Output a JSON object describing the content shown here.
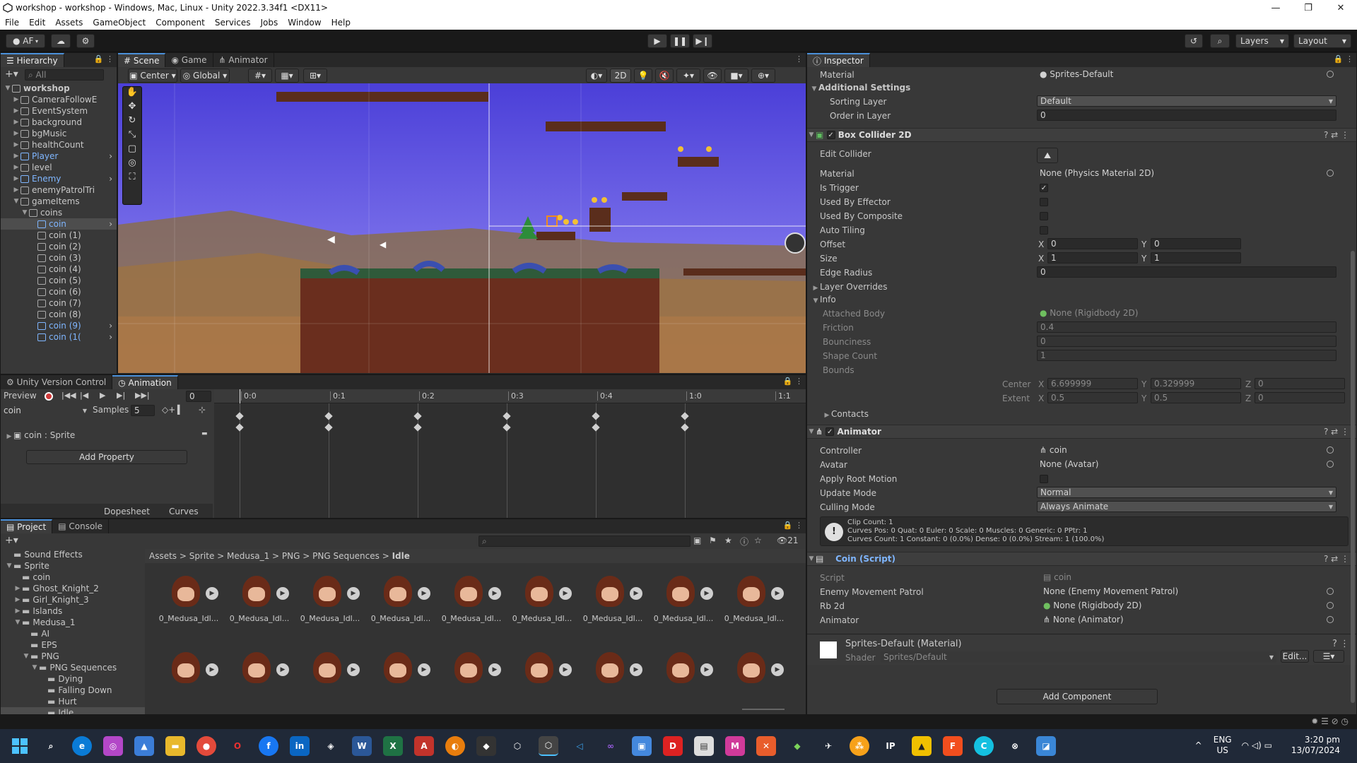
{
  "window": {
    "title": "workshop - workshop - Windows, Mac, Linux - Unity 2022.3.34f1 <DX11>",
    "controls": [
      "—",
      "❐",
      "✕"
    ]
  },
  "menu": [
    "File",
    "Edit",
    "Assets",
    "GameObject",
    "Component",
    "Services",
    "Jobs",
    "Window",
    "Help"
  ],
  "toolbar": {
    "account": "AF",
    "layers_label": "Layers",
    "layout_label": "Layout"
  },
  "hierarchy": {
    "tab": "Hierarchy",
    "search_placeholder": "All",
    "items": [
      {
        "label": "workshop",
        "indent": 0,
        "expanded": true,
        "scene": true
      },
      {
        "label": "CameraFollowE",
        "indent": 1
      },
      {
        "label": "EventSystem",
        "indent": 1
      },
      {
        "label": "background",
        "indent": 1
      },
      {
        "label": "bgMusic",
        "indent": 1
      },
      {
        "label": "healthCount",
        "indent": 1
      },
      {
        "label": "Player",
        "indent": 1,
        "prefab": true
      },
      {
        "label": "level",
        "indent": 1
      },
      {
        "label": "Enemy",
        "indent": 1,
        "prefab": true
      },
      {
        "label": "enemyPatrolTri",
        "indent": 1
      },
      {
        "label": "gameItems",
        "indent": 1,
        "expanded": true
      },
      {
        "label": "coins",
        "indent": 2,
        "expanded": true
      },
      {
        "label": "coin",
        "indent": 3,
        "selected": true,
        "prefab": true
      },
      {
        "label": "coin (1)",
        "indent": 3
      },
      {
        "label": "coin (2)",
        "indent": 3
      },
      {
        "label": "coin (3)",
        "indent": 3
      },
      {
        "label": "coin (4)",
        "indent": 3
      },
      {
        "label": "coin (5)",
        "indent": 3
      },
      {
        "label": "coin (6)",
        "indent": 3
      },
      {
        "label": "coin (7)",
        "indent": 3
      },
      {
        "label": "coin (8)",
        "indent": 3
      },
      {
        "label": "coin (9)",
        "indent": 3,
        "prefab": true
      },
      {
        "label": "coin (1(",
        "indent": 3,
        "prefab": true
      }
    ]
  },
  "scene_tabs": [
    "Scene",
    "Game",
    "Animator"
  ],
  "scene_toolbar": {
    "pivot": "Center",
    "space": "Global",
    "mode_2d": "2D"
  },
  "animation": {
    "tabs": [
      "Unity Version Control",
      "Animation"
    ],
    "preview": "Preview",
    "frame": "0",
    "clip": "coin",
    "samples_label": "Samples",
    "samples_value": "5",
    "property": "coin : Sprite",
    "add_property": "Add Property",
    "time_ticks": [
      "0:0",
      "0:1",
      "0:2",
      "0:3",
      "0:4",
      "1:0",
      "1:1"
    ],
    "bottom_tabs": [
      "Dopesheet",
      "Curves"
    ]
  },
  "project": {
    "tabs": [
      "Project",
      "Console"
    ],
    "breadcrumb": [
      "Assets",
      "Sprite",
      "Medusa_1",
      "PNG",
      "PNG Sequences",
      "Idle"
    ],
    "count": "21",
    "tree": [
      {
        "label": "Sound Effects",
        "indent": 1
      },
      {
        "label": "Sprite",
        "indent": 1,
        "expanded": true
      },
      {
        "label": "coin",
        "indent": 2
      },
      {
        "label": "Ghost_Knight_2",
        "indent": 2,
        "collapsed": true
      },
      {
        "label": "Girl_Knight_3",
        "indent": 2,
        "collapsed": true
      },
      {
        "label": "Islands",
        "indent": 2,
        "collapsed": true
      },
      {
        "label": "Medusa_1",
        "indent": 2,
        "expanded": true
      },
      {
        "label": "AI",
        "indent": 3
      },
      {
        "label": "EPS",
        "indent": 3
      },
      {
        "label": "PNG",
        "indent": 3,
        "expanded": true
      },
      {
        "label": "PNG Sequences",
        "indent": 4,
        "expanded": true
      },
      {
        "label": "Dying",
        "indent": 5
      },
      {
        "label": "Falling Down",
        "indent": 5
      },
      {
        "label": "Hurt",
        "indent": 5
      },
      {
        "label": "Idle",
        "indent": 5,
        "selected": true
      }
    ],
    "asset_caption": "0_Medusa_Idl...",
    "assets_row1": 9,
    "assets_row2": 9
  },
  "inspector": {
    "tab": "Inspector",
    "material_label": "Material",
    "material_value": "Sprites-Default",
    "additional_settings": "Additional Settings",
    "sorting_layer_label": "Sorting Layer",
    "sorting_layer_value": "Default",
    "order_label": "Order in Layer",
    "order_value": "0",
    "box_collider": {
      "title": "Box Collider 2D",
      "edit_collider": "Edit Collider",
      "material_label": "Material",
      "material_value": "None (Physics Material 2D)",
      "is_trigger": "Is Trigger",
      "used_by_effector": "Used By Effector",
      "used_by_composite": "Used By Composite",
      "auto_tiling": "Auto Tiling",
      "offset_label": "Offset",
      "offset_x": "0",
      "offset_y": "0",
      "size_label": "Size",
      "size_x": "1",
      "size_y": "1",
      "edge_radius_label": "Edge Radius",
      "edge_radius_value": "0",
      "layer_overrides": "Layer Overrides",
      "info": "Info",
      "attached_body_label": "Attached Body",
      "attached_body_value": "None (Rigidbody 2D)",
      "friction_label": "Friction",
      "friction_value": "0.4",
      "bounciness_label": "Bounciness",
      "bounciness_value": "0",
      "shape_count_label": "Shape Count",
      "shape_count_value": "1",
      "bounds_label": "Bounds",
      "center_label": "Center",
      "center_x": "6.699999",
      "center_y": "0.329999",
      "center_z": "0",
      "extent_label": "Extent",
      "extent_x": "0.5",
      "extent_y": "0.5",
      "extent_z": "0",
      "contacts": "Contacts"
    },
    "animator": {
      "title": "Animator",
      "controller_label": "Controller",
      "controller_value": "coin",
      "avatar_label": "Avatar",
      "avatar_value": "None (Avatar)",
      "apply_root_motion": "Apply Root Motion",
      "update_mode_label": "Update Mode",
      "update_mode_value": "Normal",
      "culling_mode_label": "Culling Mode",
      "culling_mode_value": "Always Animate",
      "info_line1": "Clip Count: 1",
      "info_line2": "Curves Pos: 0 Quat: 0 Euler: 0 Scale: 0 Muscles: 0 Generic: 0 PPtr: 1",
      "info_line3": "Curves Count: 1 Constant: 0 (0.0%) Dense: 0 (0.0%) Stream: 1 (100.0%)"
    },
    "coin_script": {
      "title": "Coin (Script)",
      "script_label": "Script",
      "script_value": "coin",
      "enemy_patrol_label": "Enemy Movement Patrol",
      "enemy_patrol_value": "None (Enemy Movement Patrol)",
      "rb2d_label": "Rb 2d",
      "rb2d_value": "None (Rigidbody 2D)",
      "animator_label": "Animator",
      "animator_value": "None (Animator)"
    },
    "material_block": {
      "title": "Sprites-Default (Material)",
      "shader_label": "Shader",
      "shader_value": "Sprites/Default",
      "edit_label": "Edit..."
    },
    "add_component": "Add Component"
  },
  "taskbar": {
    "lang1": "ENG",
    "lang2": "US",
    "time": "3:20 pm",
    "date": "13/07/2024"
  }
}
